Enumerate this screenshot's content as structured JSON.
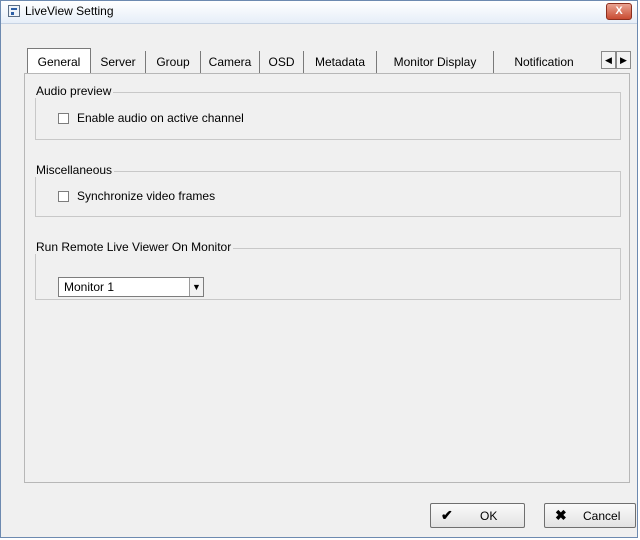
{
  "window": {
    "title": "LiveView Setting",
    "close_glyph": "X"
  },
  "tabs": [
    {
      "label": "General",
      "active": true
    },
    {
      "label": "Server"
    },
    {
      "label": "Group"
    },
    {
      "label": "Camera"
    },
    {
      "label": "OSD"
    },
    {
      "label": "Metadata"
    },
    {
      "label": "Monitor Display"
    },
    {
      "label": "Notification"
    }
  ],
  "tab_scroll": {
    "left_glyph": "◀",
    "right_glyph": "▶"
  },
  "audio_preview": {
    "title": "Audio preview",
    "checkbox_label": "Enable audio on active channel",
    "checked": false
  },
  "miscellaneous": {
    "title": "Miscellaneous",
    "checkbox_label": "Synchronize video frames",
    "checked": false
  },
  "remote_viewer": {
    "title": "Run Remote Live Viewer On Monitor",
    "selected": "Monitor 1",
    "arrow_glyph": "▼"
  },
  "buttons": {
    "ok_label": "OK",
    "ok_icon": "✔",
    "cancel_label": "Cancel",
    "cancel_icon": "✖"
  }
}
